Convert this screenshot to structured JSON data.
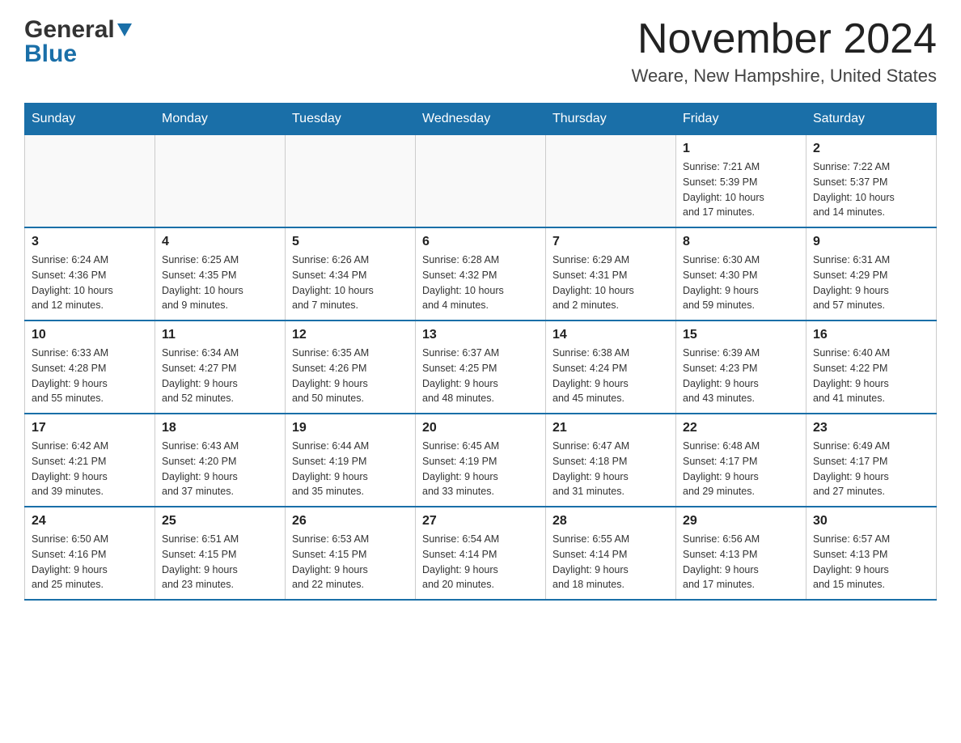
{
  "header": {
    "logo_general": "General",
    "logo_blue": "Blue",
    "month_year": "November 2024",
    "location": "Weare, New Hampshire, United States"
  },
  "days_of_week": [
    "Sunday",
    "Monday",
    "Tuesday",
    "Wednesday",
    "Thursday",
    "Friday",
    "Saturday"
  ],
  "weeks": [
    [
      {
        "day": "",
        "info": ""
      },
      {
        "day": "",
        "info": ""
      },
      {
        "day": "",
        "info": ""
      },
      {
        "day": "",
        "info": ""
      },
      {
        "day": "",
        "info": ""
      },
      {
        "day": "1",
        "info": "Sunrise: 7:21 AM\nSunset: 5:39 PM\nDaylight: 10 hours\nand 17 minutes."
      },
      {
        "day": "2",
        "info": "Sunrise: 7:22 AM\nSunset: 5:37 PM\nDaylight: 10 hours\nand 14 minutes."
      }
    ],
    [
      {
        "day": "3",
        "info": "Sunrise: 6:24 AM\nSunset: 4:36 PM\nDaylight: 10 hours\nand 12 minutes."
      },
      {
        "day": "4",
        "info": "Sunrise: 6:25 AM\nSunset: 4:35 PM\nDaylight: 10 hours\nand 9 minutes."
      },
      {
        "day": "5",
        "info": "Sunrise: 6:26 AM\nSunset: 4:34 PM\nDaylight: 10 hours\nand 7 minutes."
      },
      {
        "day": "6",
        "info": "Sunrise: 6:28 AM\nSunset: 4:32 PM\nDaylight: 10 hours\nand 4 minutes."
      },
      {
        "day": "7",
        "info": "Sunrise: 6:29 AM\nSunset: 4:31 PM\nDaylight: 10 hours\nand 2 minutes."
      },
      {
        "day": "8",
        "info": "Sunrise: 6:30 AM\nSunset: 4:30 PM\nDaylight: 9 hours\nand 59 minutes."
      },
      {
        "day": "9",
        "info": "Sunrise: 6:31 AM\nSunset: 4:29 PM\nDaylight: 9 hours\nand 57 minutes."
      }
    ],
    [
      {
        "day": "10",
        "info": "Sunrise: 6:33 AM\nSunset: 4:28 PM\nDaylight: 9 hours\nand 55 minutes."
      },
      {
        "day": "11",
        "info": "Sunrise: 6:34 AM\nSunset: 4:27 PM\nDaylight: 9 hours\nand 52 minutes."
      },
      {
        "day": "12",
        "info": "Sunrise: 6:35 AM\nSunset: 4:26 PM\nDaylight: 9 hours\nand 50 minutes."
      },
      {
        "day": "13",
        "info": "Sunrise: 6:37 AM\nSunset: 4:25 PM\nDaylight: 9 hours\nand 48 minutes."
      },
      {
        "day": "14",
        "info": "Sunrise: 6:38 AM\nSunset: 4:24 PM\nDaylight: 9 hours\nand 45 minutes."
      },
      {
        "day": "15",
        "info": "Sunrise: 6:39 AM\nSunset: 4:23 PM\nDaylight: 9 hours\nand 43 minutes."
      },
      {
        "day": "16",
        "info": "Sunrise: 6:40 AM\nSunset: 4:22 PM\nDaylight: 9 hours\nand 41 minutes."
      }
    ],
    [
      {
        "day": "17",
        "info": "Sunrise: 6:42 AM\nSunset: 4:21 PM\nDaylight: 9 hours\nand 39 minutes."
      },
      {
        "day": "18",
        "info": "Sunrise: 6:43 AM\nSunset: 4:20 PM\nDaylight: 9 hours\nand 37 minutes."
      },
      {
        "day": "19",
        "info": "Sunrise: 6:44 AM\nSunset: 4:19 PM\nDaylight: 9 hours\nand 35 minutes."
      },
      {
        "day": "20",
        "info": "Sunrise: 6:45 AM\nSunset: 4:19 PM\nDaylight: 9 hours\nand 33 minutes."
      },
      {
        "day": "21",
        "info": "Sunrise: 6:47 AM\nSunset: 4:18 PM\nDaylight: 9 hours\nand 31 minutes."
      },
      {
        "day": "22",
        "info": "Sunrise: 6:48 AM\nSunset: 4:17 PM\nDaylight: 9 hours\nand 29 minutes."
      },
      {
        "day": "23",
        "info": "Sunrise: 6:49 AM\nSunset: 4:17 PM\nDaylight: 9 hours\nand 27 minutes."
      }
    ],
    [
      {
        "day": "24",
        "info": "Sunrise: 6:50 AM\nSunset: 4:16 PM\nDaylight: 9 hours\nand 25 minutes."
      },
      {
        "day": "25",
        "info": "Sunrise: 6:51 AM\nSunset: 4:15 PM\nDaylight: 9 hours\nand 23 minutes."
      },
      {
        "day": "26",
        "info": "Sunrise: 6:53 AM\nSunset: 4:15 PM\nDaylight: 9 hours\nand 22 minutes."
      },
      {
        "day": "27",
        "info": "Sunrise: 6:54 AM\nSunset: 4:14 PM\nDaylight: 9 hours\nand 20 minutes."
      },
      {
        "day": "28",
        "info": "Sunrise: 6:55 AM\nSunset: 4:14 PM\nDaylight: 9 hours\nand 18 minutes."
      },
      {
        "day": "29",
        "info": "Sunrise: 6:56 AM\nSunset: 4:13 PM\nDaylight: 9 hours\nand 17 minutes."
      },
      {
        "day": "30",
        "info": "Sunrise: 6:57 AM\nSunset: 4:13 PM\nDaylight: 9 hours\nand 15 minutes."
      }
    ]
  ]
}
